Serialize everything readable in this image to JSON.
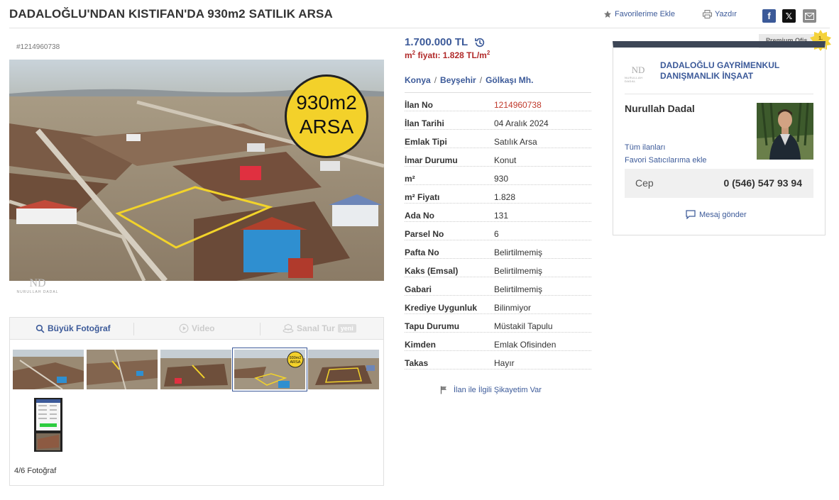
{
  "header": {
    "title": "DADALOĞLU'NDAN KISTIFAN'DA 930m2 SATILIK ARSA",
    "favorite_label": "Favorilerime Ekle",
    "print_label": "Yazdır",
    "share_icons": [
      "facebook-icon",
      "x-icon",
      "mail-icon"
    ]
  },
  "gallery": {
    "classified_id": "#1214960738",
    "photo_badge_line1": "930m2",
    "photo_badge_line2": "ARSA",
    "watermark": "NURULLAH DADAL",
    "watermark_mono": "ND",
    "tabs": {
      "photo": "Büyük Fotoğraf",
      "video": "Video",
      "tour": "Sanal Tur",
      "tour_badge": "yeni"
    },
    "thumb_badge_line1": "930m2",
    "thumb_badge_line2": "ARSA",
    "counter": "4/6 Fotoğraf",
    "selected_index": 4,
    "thumbnail_count": 6
  },
  "listing": {
    "price": "1.700.000 TL",
    "unit_price_prefix": "m",
    "unit_price_sup": "2",
    "unit_price_text": " fiyatı: 1.828 TL/m",
    "unit_price_sup2": "2",
    "location": [
      "Konya",
      "Beyşehir",
      "Gölkaşı Mh."
    ],
    "location_sep": "/",
    "details": [
      {
        "label": "İlan No",
        "value": "1214960738"
      },
      {
        "label": "İlan Tarihi",
        "value": "04 Aralık 2024"
      },
      {
        "label": "Emlak Tipi",
        "value": "Satılık Arsa"
      },
      {
        "label": "İmar Durumu",
        "value": "Konut"
      },
      {
        "label": "m²",
        "value": "930"
      },
      {
        "label": "m² Fiyatı",
        "value": "1.828"
      },
      {
        "label": "Ada No",
        "value": "131"
      },
      {
        "label": "Parsel No",
        "value": "6"
      },
      {
        "label": "Pafta No",
        "value": "Belirtilmemiş"
      },
      {
        "label": "Kaks (Emsal)",
        "value": "Belirtilmemiş"
      },
      {
        "label": "Gabari",
        "value": "Belirtilmemiş"
      },
      {
        "label": "Krediye Uygunluk",
        "value": "Bilinmiyor"
      },
      {
        "label": "Tapu Durumu",
        "value": "Müstakil Tapulu"
      },
      {
        "label": "Kimden",
        "value": "Emlak Ofisinden"
      },
      {
        "label": "Takas",
        "value": "Hayır"
      }
    ],
    "complaint_label": "İlan ile İlgili Şikayetim Var"
  },
  "seller": {
    "premium_label": "Premium Ofis",
    "year_badge_line1": "1.",
    "year_badge_line2": "YIL",
    "agency_logo_mono": "ND",
    "agency_logo_text": "NURULLAH DADAL",
    "agency_name": "DADALOĞLU GAYRİMENKUL DANIŞMANLIK İNŞAAT",
    "name": "Nurullah Dadal",
    "all_listings": "Tüm ilanları",
    "add_favorite_seller": "Favori Satıcılarıma ekle",
    "phone_label": "Cep",
    "phone_number": "0 (546) 547 93 94",
    "message_label": "Mesaj gönder"
  },
  "colors": {
    "accent": "#3c5a99",
    "price_red": "#b12a2a",
    "card_top": "#3d4656"
  }
}
